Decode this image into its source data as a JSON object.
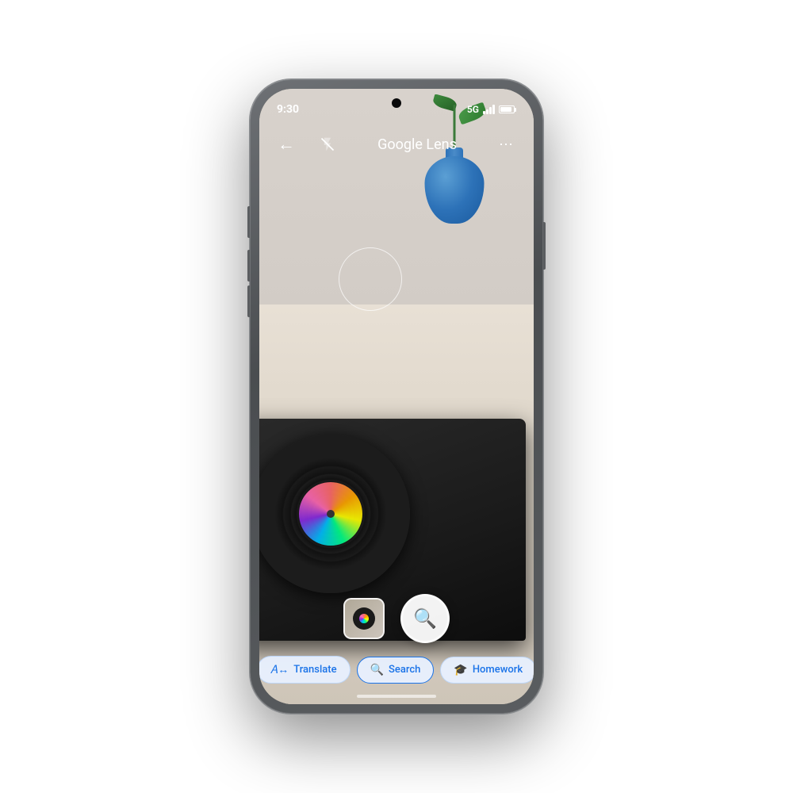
{
  "phone": {
    "status_bar": {
      "time": "9:30",
      "network": "5G"
    },
    "top_bar": {
      "title": "Google Lens",
      "back_icon": "←",
      "flash_icon": "flash-off",
      "more_icon": "⋯"
    },
    "camera": {
      "subject": "vinyl turntable with holographic record label and blue vase",
      "scan_circle_visible": true
    },
    "bottom": {
      "tabs": [
        {
          "label": "Translate",
          "icon": "translate"
        },
        {
          "label": "Search",
          "icon": "search"
        },
        {
          "label": "Homework",
          "icon": "homework"
        }
      ],
      "active_tab": "Search",
      "shutter_icon": "search",
      "home_indicator": true
    }
  }
}
